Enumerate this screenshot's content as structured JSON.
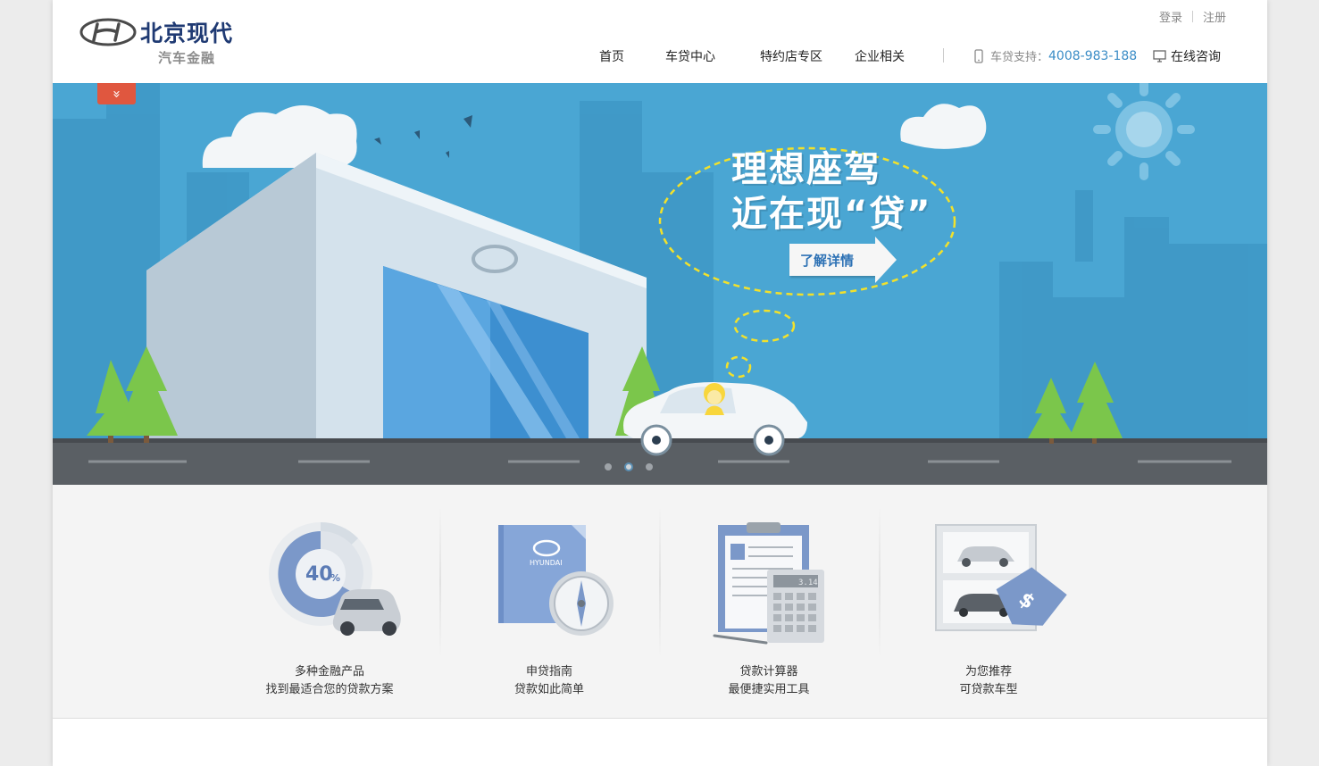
{
  "header": {
    "logo": {
      "brand": "北京现代",
      "sub": "汽车金融",
      "icon": "hyundai-logo-icon"
    },
    "auth": {
      "login": "登录",
      "register": "注册"
    },
    "nav": [
      {
        "label": "首页"
      },
      {
        "label": "车贷中心"
      },
      {
        "label": "特约店专区"
      },
      {
        "label": "企业相关"
      }
    ],
    "support": {
      "label": "车贷支持：",
      "phone": "4008-983-188",
      "icon": "mobile-phone-icon"
    },
    "consult": {
      "label": "在线咨询",
      "icon": "monitor-icon"
    }
  },
  "banner": {
    "headline_line1": "理想座驾",
    "headline_line2": "近在现“贷”",
    "cta": "了解详情",
    "toggle": "»",
    "slide_count": 3,
    "active_slide": 2,
    "colors": {
      "sky": "#4aa6d3",
      "road": "#5a5f64",
      "accent": "#e0573f",
      "dash": "#f2e12b"
    }
  },
  "features": [
    {
      "line1": "多种金融产品",
      "line2": "找到最适合您的贷款方案",
      "icon": "pie-chart-car-icon",
      "badge": "40",
      "badge_unit": "%"
    },
    {
      "line1": "申贷指南",
      "line2": "贷款如此简单",
      "icon": "guidebook-compass-icon",
      "book_label": "HYUNDAI"
    },
    {
      "line1": "贷款计算器",
      "line2": "最便捷实用工具",
      "icon": "clipboard-calculator-icon",
      "display": "3.14"
    },
    {
      "line1": "为您推荐",
      "line2": "可贷款车型",
      "icon": "car-showcase-tag-icon"
    }
  ]
}
